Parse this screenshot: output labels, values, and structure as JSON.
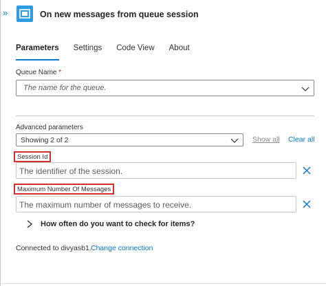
{
  "header": {
    "expand_glyph": "»",
    "trigger_icon": "service-bus-queue-icon",
    "title": "On new messages from queue session"
  },
  "tabs": [
    {
      "label": "Parameters",
      "active": true
    },
    {
      "label": "Settings",
      "active": false
    },
    {
      "label": "Code View",
      "active": false
    },
    {
      "label": "About",
      "active": false
    }
  ],
  "queue_name": {
    "label": "Queue Name",
    "required_mark": "*",
    "placeholder": "The name for the queue."
  },
  "advanced": {
    "label": "Advanced parameters",
    "selected": "Showing 2 of 2",
    "show_all": "Show all",
    "clear_all": "Clear all"
  },
  "session_id": {
    "label": "Session Id",
    "placeholder": "The identifier of the session."
  },
  "max_messages": {
    "label": "Maximum Number Of Messages",
    "placeholder": "The maximum number of messages to receive."
  },
  "recurrence": {
    "label": "How often do you want to check for items?"
  },
  "connection": {
    "text": "Connected to divyasb1.",
    "change_label": "Change connection"
  },
  "colors": {
    "accent": "#0078d4",
    "icon_bg": "#2d9ce3",
    "highlight": "#d32f2f",
    "required": "#a4262c"
  }
}
